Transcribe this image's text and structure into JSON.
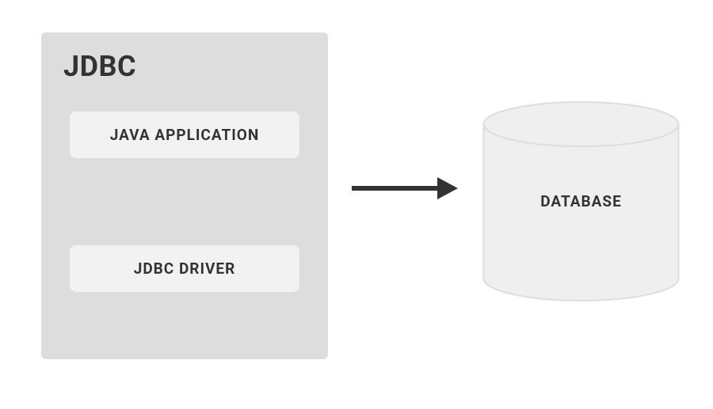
{
  "diagram": {
    "container_title": "JDBC",
    "app_box_label": "JAVA APPLICATION",
    "driver_box_label": "JDBC DRIVER",
    "database_label": "DATABASE"
  },
  "colors": {
    "container_bg": "#dddddd",
    "box_bg": "#f2f2f2",
    "text": "#333333",
    "arrow": "#333333",
    "cylinder_fill": "#efefef",
    "cylinder_stroke": "#dddddd"
  }
}
